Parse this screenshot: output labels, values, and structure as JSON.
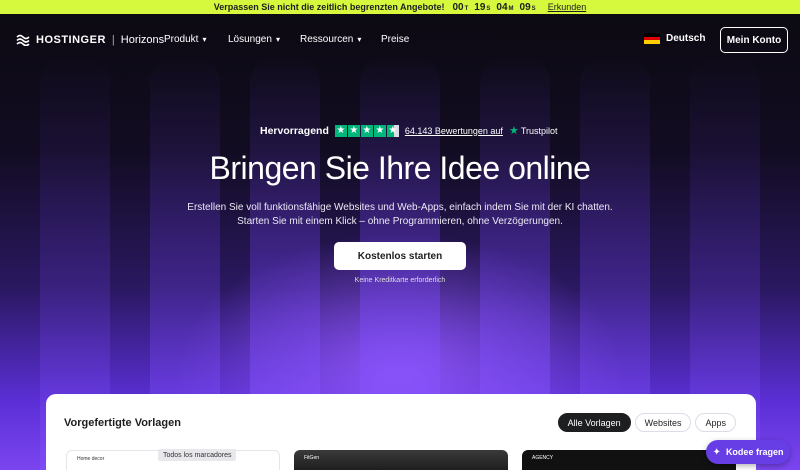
{
  "promo": {
    "text": "Verpassen Sie nicht die zeitlich begrenzten Angebote!",
    "countdown": [
      {
        "value": "00",
        "unit": "T"
      },
      {
        "value": "19",
        "unit": "S"
      },
      {
        "value": "04",
        "unit": "M"
      },
      {
        "value": "09",
        "unit": "S"
      }
    ],
    "link": "Erkunden"
  },
  "nav": {
    "brand": "HOSTINGER",
    "separator": "|",
    "product": "Horizons",
    "menu": [
      "Produkt",
      "Lösungen",
      "Ressourcen",
      "Preise"
    ],
    "language": "Deutsch",
    "account": "Mein Konto"
  },
  "trust": {
    "rating_label": "Hervorragend",
    "rating_stars": 4.5,
    "reviews": "64.143 Bewertungen auf",
    "provider": "Trustpilot"
  },
  "hero": {
    "title": "Bringen Sie Ihre Idee online",
    "subtitle_line1": "Erstellen Sie voll funktionsfähige Websites und Web-Apps, einfach indem Sie mit der KI chatten.",
    "subtitle_line2": "Starten Sie mit einem Klick – ohne Programmieren, ohne Verzögerungen.",
    "cta": "Kostenlos starten",
    "cta_note": "Keine Kreditkarte erforderlich"
  },
  "templates": {
    "title": "Vorgefertigte Vorlagen",
    "filters": [
      "Alle Vorlagen",
      "Websites",
      "Apps"
    ],
    "active_filter": "Alle Vorlagen",
    "thumb_labels": [
      "Home decor",
      "FitGen",
      "AGENCY"
    ]
  },
  "tooltip": "Todos los marcadores",
  "assistant": {
    "label": "Kodee fragen"
  },
  "colors": {
    "promo_bg": "#d6f83d",
    "accent": "#673de6",
    "trustpilot": "#00b67a"
  }
}
